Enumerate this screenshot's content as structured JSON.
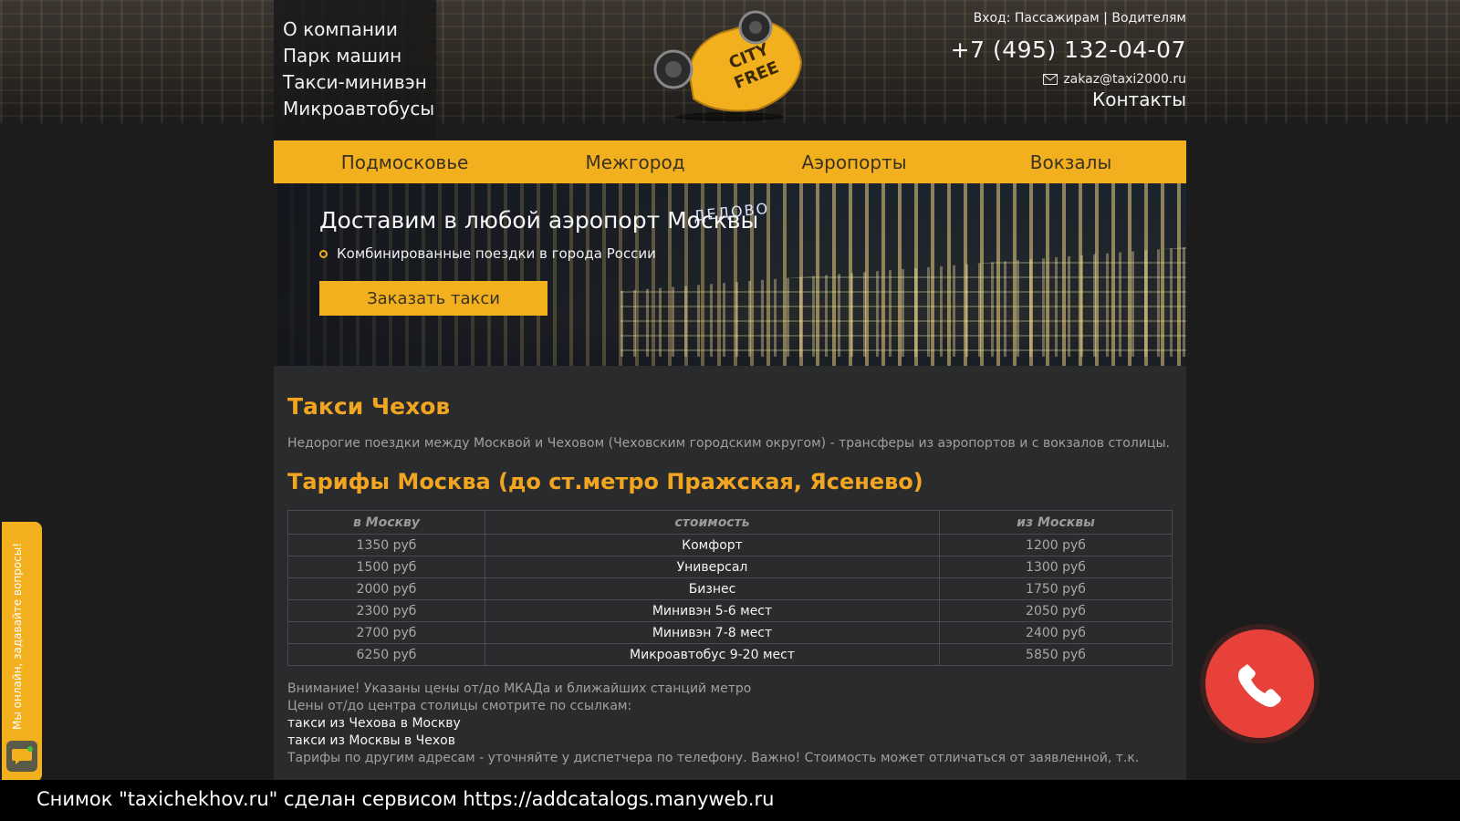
{
  "top_menu": [
    "О компании",
    "Парк машин",
    "Такси-минивэн",
    "Микроавтобусы"
  ],
  "logo": {
    "line1": "CITY",
    "line2": "FREE"
  },
  "header": {
    "login_prefix": "Вход:",
    "login_passengers": "Пассажирам",
    "login_separator": "|",
    "login_drivers": "Водителям",
    "phone": "+7 (495) 132-04-07",
    "email": "zakaz@taxi2000.ru",
    "contacts": "Контакты"
  },
  "nav": [
    "Подмосковье",
    "Межгород",
    "Аэропорты",
    "Вокзалы"
  ],
  "banner": {
    "title": "Доставим в любой аэропорт Москвы",
    "subtitle": "Комбинированные поездки в города России",
    "button": "Заказать такси",
    "sign_text": "ДЕДОВО"
  },
  "content": {
    "title": "Такси Чехов",
    "intro": "Недорогие поездки между Москвой и Чеховом (Чеховским городским округом) - трансферы из аэропортов и с вокзалов столицы.",
    "tariffs_title": "Тарифы Москва (до ст.метро Пражская, Ясенево)",
    "table_headers": [
      "в Москву",
      "стоимость",
      "из Москвы"
    ],
    "table_rows": [
      [
        "1350 руб",
        "Комфорт",
        "1200 руб"
      ],
      [
        "1500 руб",
        "Универсал",
        "1300 руб"
      ],
      [
        "2000 руб",
        "Бизнес",
        "1750 руб"
      ],
      [
        "2300 руб",
        "Минивэн 5-6 мест",
        "2050 руб"
      ],
      [
        "2700 руб",
        "Минивэн 7-8 мест",
        "2400 руб"
      ],
      [
        "6250 руб",
        "Микроавтобус 9-20 мест",
        "5850 руб"
      ]
    ],
    "note1": "Внимание! Указаны цены от/до МКАДа и ближайших станций метро",
    "note2": "Цены от/до центра столицы смотрите по ссылкам:",
    "link1": "такси из Чехова в Москву",
    "link2": "такси из Москвы в Чехов",
    "note3": "Тарифы по другим адресам - уточняйте у диспетчера по телефону. Важно! Стоимость может отличаться от заявленной, т.к."
  },
  "chat": {
    "label": "Мы онлайн, задавайте вопросы!"
  },
  "footer": "Снимок \"taxichekhov.ru\" сделан сервисом https://addcatalogs.manyweb.ru",
  "colors": {
    "accent": "#f2b01e",
    "heading": "#f2a520",
    "call": "#e8413a"
  }
}
